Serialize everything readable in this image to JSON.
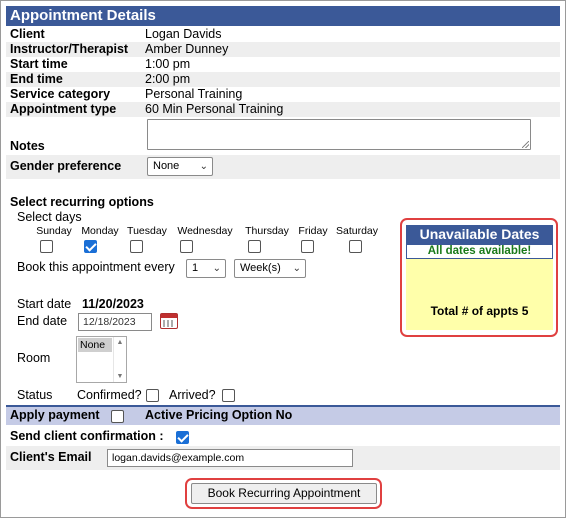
{
  "header": {
    "title": "Appointment Details"
  },
  "details": [
    {
      "label": "Client",
      "value": "Logan Davids"
    },
    {
      "label": "Instructor/Therapist",
      "value": "Amber Dunney"
    },
    {
      "label": "Start time",
      "value": "1:00 pm"
    },
    {
      "label": "End time",
      "value": "2:00 pm"
    },
    {
      "label": "Service category",
      "value": "Personal Training"
    },
    {
      "label": "Appointment type",
      "value": "60 Min Personal Training"
    }
  ],
  "notes": {
    "label": "Notes",
    "value": ""
  },
  "gender": {
    "label": "Gender preference",
    "selected": "None"
  },
  "recurring": {
    "title": "Select recurring options",
    "select_days_label": "Select days",
    "days": [
      {
        "label": "Sunday",
        "checked": false
      },
      {
        "label": "Monday",
        "checked": true
      },
      {
        "label": "Tuesday",
        "checked": false
      },
      {
        "label": "Wednesday",
        "checked": false
      },
      {
        "label": "Thursday",
        "checked": false
      },
      {
        "label": "Friday",
        "checked": false
      },
      {
        "label": "Saturday",
        "checked": false
      }
    ],
    "book_every_label": "Book this appointment every",
    "every_count": "1",
    "every_unit": "Week(s)",
    "start_date_label": "Start date",
    "start_date": "11/20/2023",
    "end_date_label": "End date",
    "end_date": "12/18/2023",
    "room_label": "Room",
    "room_selected": "None",
    "status_label": "Status",
    "confirmed_label": "Confirmed?",
    "arrived_label": "Arrived?"
  },
  "unavailable": {
    "title": "Unavailable Dates",
    "message": "All dates available!",
    "total": "Total # of appts 5"
  },
  "payment": {
    "apply_label": "Apply payment",
    "pricing_label": "Active Pricing Option No"
  },
  "confirmation": {
    "label": "Send client confirmation :"
  },
  "email": {
    "label": "Client's Email",
    "value": "logan.davids@example.com"
  },
  "actions": {
    "book_button": "Book Recurring Appointment"
  },
  "colors": {
    "header_bg": "#3b5998",
    "highlight": "#e04040",
    "available_text": "#1a7a1a",
    "panel_bg": "#ffffaa",
    "checkbox_checked": "#1a6fd6"
  }
}
